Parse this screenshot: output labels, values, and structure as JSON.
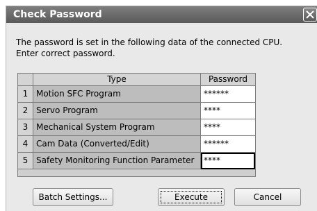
{
  "dialog": {
    "title": "Check Password",
    "message_line1": "The password is set in the following data of the connected CPU.",
    "message_line2": "Enter correct password."
  },
  "table": {
    "headers": {
      "number": "",
      "type": "Type",
      "password": "Password"
    },
    "rows": [
      {
        "number": "1",
        "type": "Motion SFC Program",
        "password": "******"
      },
      {
        "number": "2",
        "type": "Servo Program",
        "password": "****"
      },
      {
        "number": "3",
        "type": "Mechanical System Program",
        "password": "****"
      },
      {
        "number": "4",
        "type": "Cam Data (Converted/Edit)",
        "password": "******"
      },
      {
        "number": "5",
        "type": "Safety Monitoring Function Parameter",
        "password": "****"
      }
    ]
  },
  "buttons": {
    "batch_settings": "Batch Settings...",
    "execute": "Execute",
    "cancel": "Cancel"
  },
  "icons": {
    "close": "close-icon"
  }
}
